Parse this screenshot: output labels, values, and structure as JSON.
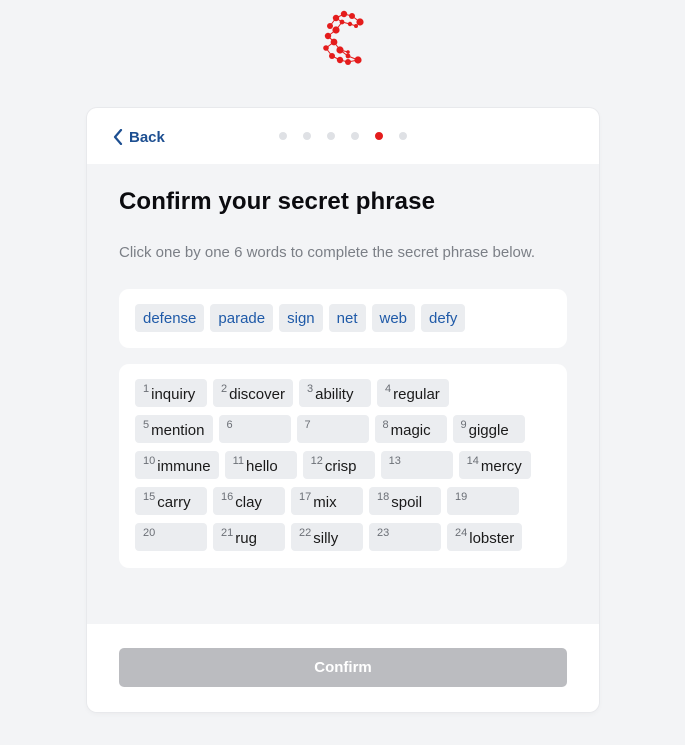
{
  "header": {
    "back_label": "Back",
    "steps_total": 6,
    "active_step": 5
  },
  "title": "Confirm your secret phrase",
  "subtitle": "Click one by one 6 words to complete the secret phrase below.",
  "choices": [
    "defense",
    "parade",
    "sign",
    "net",
    "web",
    "defy"
  ],
  "slots": [
    [
      {
        "n": "1",
        "w": "inquiry"
      },
      {
        "n": "2",
        "w": "discover"
      },
      {
        "n": "3",
        "w": "ability"
      },
      {
        "n": "4",
        "w": "regular"
      }
    ],
    [
      {
        "n": "5",
        "w": "mention"
      },
      {
        "n": "6",
        "w": ""
      },
      {
        "n": "7",
        "w": ""
      },
      {
        "n": "8",
        "w": "magic"
      },
      {
        "n": "9",
        "w": "giggle"
      }
    ],
    [
      {
        "n": "10",
        "w": "immune"
      },
      {
        "n": "11",
        "w": "hello"
      },
      {
        "n": "12",
        "w": "crisp"
      },
      {
        "n": "13",
        "w": ""
      },
      {
        "n": "14",
        "w": "mercy"
      }
    ],
    [
      {
        "n": "15",
        "w": "carry"
      },
      {
        "n": "16",
        "w": "clay"
      },
      {
        "n": "17",
        "w": "mix"
      },
      {
        "n": "18",
        "w": "spoil"
      },
      {
        "n": "19",
        "w": ""
      }
    ],
    [
      {
        "n": "20",
        "w": ""
      },
      {
        "n": "21",
        "w": "rug"
      },
      {
        "n": "22",
        "w": "silly"
      },
      {
        "n": "23",
        "w": ""
      },
      {
        "n": "24",
        "w": "lobster"
      }
    ]
  ],
  "footer": {
    "confirm_label": "Confirm"
  },
  "colors": {
    "accent": "#e41c1c",
    "link": "#1d4f91",
    "button_disabled": "#bbbcc0"
  }
}
